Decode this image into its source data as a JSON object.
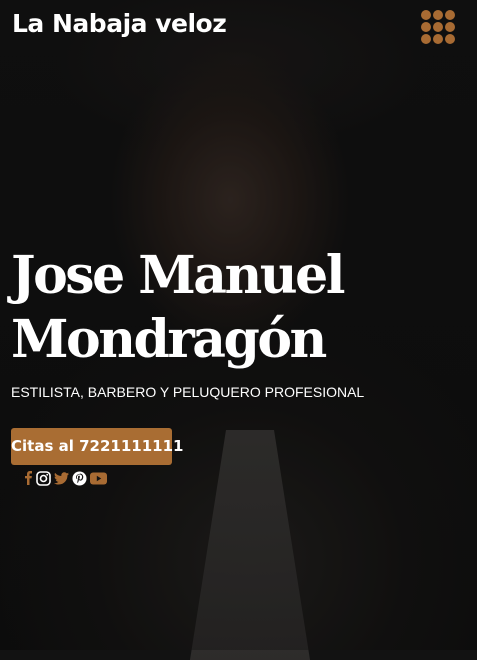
{
  "header": {
    "brand": "La Nabaja veloz",
    "menu_icon": "grid-menu-icon"
  },
  "hero": {
    "name_line1": "Jose Manuel",
    "name_line2": "Mondragón",
    "tagline": "ESTILISTA, BARBERO Y PELUQUERO PROFESIONAL",
    "cta_label": "Citas al 7221111111"
  },
  "social": [
    {
      "icon": "facebook-icon",
      "color": "#a86b33"
    },
    {
      "icon": "instagram-icon",
      "color": "#ffffff"
    },
    {
      "icon": "twitter-icon",
      "color": "#a86b33"
    },
    {
      "icon": "pinterest-icon",
      "color": "#ffffff"
    },
    {
      "icon": "youtube-icon",
      "color": "#a86b33"
    }
  ],
  "colors": {
    "accent": "#a96d33",
    "text": "#ffffff",
    "background": "#121212"
  }
}
